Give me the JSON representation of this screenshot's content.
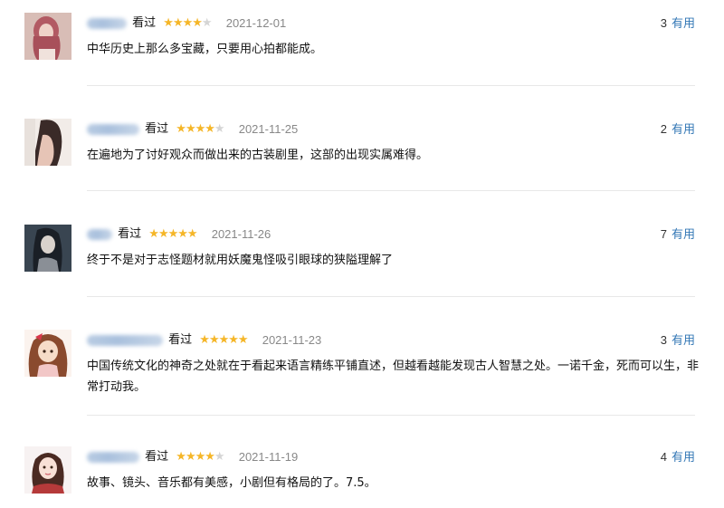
{
  "reviews": [
    {
      "status": "看过",
      "stars": "★★★★",
      "stars_empty": "★",
      "rating": 4,
      "date": "2021-12-01",
      "content": "中华历史上那么多宝藏，只要用心拍都能成。",
      "useful_count": "3",
      "useful_label": "有用"
    },
    {
      "status": "看过",
      "stars": "★★★★",
      "stars_empty": "★",
      "rating": 4,
      "date": "2021-11-25",
      "content": "在遍地为了讨好观众而做出来的古装剧里，这部的出现实属难得。",
      "useful_count": "2",
      "useful_label": "有用"
    },
    {
      "status": "看过",
      "stars": "★★★★★",
      "stars_empty": "",
      "rating": 5,
      "date": "2021-11-26",
      "content": "终于不是对于志怪题材就用妖魔鬼怪吸引眼球的狭隘理解了",
      "useful_count": "7",
      "useful_label": "有用"
    },
    {
      "status": "看过",
      "stars": "★★★★★",
      "stars_empty": "",
      "rating": 5,
      "date": "2021-11-23",
      "content": "中国传统文化的神奇之处就在于看起来语言精练平铺直述，但越看越能发现古人智慧之处。一诺千金，死而可以生，非常打动我。",
      "useful_count": "3",
      "useful_label": "有用"
    },
    {
      "status": "看过",
      "stars": "★★★★",
      "stars_empty": "★",
      "rating": 4,
      "date": "2021-11-19",
      "content": "故事、镜头、音乐都有美感，小剧但有格局的了。7.5。",
      "useful_count": "4",
      "useful_label": "有用"
    }
  ],
  "colors": {
    "star": "#f5b628",
    "star_empty": "#d5d5d5",
    "link": "#3478b6",
    "date": "#888888",
    "divider": "#e8e8e8"
  }
}
